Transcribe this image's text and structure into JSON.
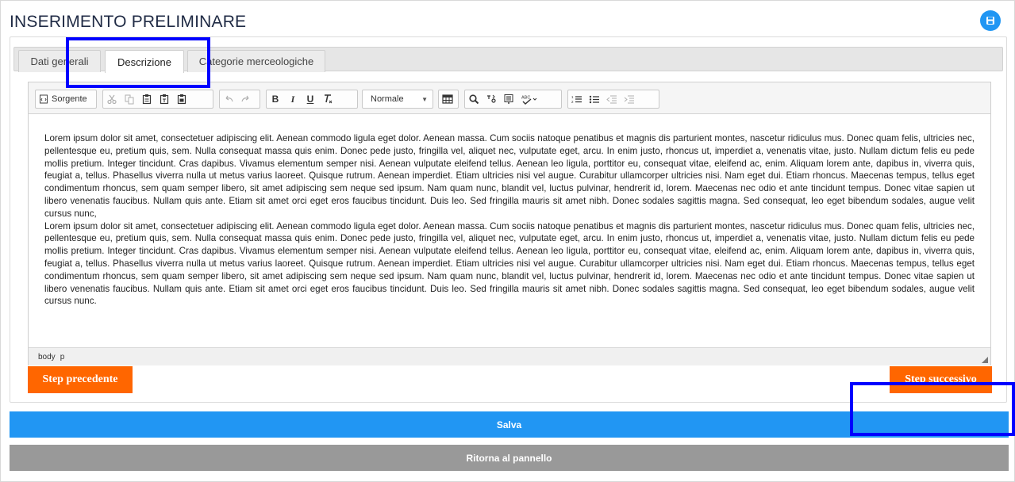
{
  "page": {
    "title": "INSERIMENTO PRELIMINARE"
  },
  "tabs": [
    {
      "label": "Dati generali"
    },
    {
      "label": "Descrizione"
    },
    {
      "label": "Categorie merceologiche"
    }
  ],
  "toolbar": {
    "source_label": "Sorgente",
    "bold_label": "B",
    "italic_label": "I",
    "underline_label": "U",
    "format_value": "Normale"
  },
  "editor": {
    "paragraph_1": "Lorem ipsum dolor sit amet, consectetuer adipiscing elit. Aenean commodo ligula eget dolor. Aenean massa. Cum sociis natoque penatibus et magnis dis parturient montes, nascetur ridiculus mus. Donec quam felis, ultricies nec, pellentesque eu, pretium quis, sem. Nulla consequat massa quis enim. Donec pede justo, fringilla vel, aliquet nec, vulputate eget, arcu. In enim justo, rhoncus ut, imperdiet a, venenatis vitae, justo. Nullam dictum felis eu pede mollis pretium. Integer tincidunt. Cras dapibus. Vivamus elementum semper nisi. Aenean vulputate eleifend tellus. Aenean leo ligula, porttitor eu, consequat vitae, eleifend ac, enim. Aliquam lorem ante, dapibus in, viverra quis, feugiat a, tellus. Phasellus viverra nulla ut metus varius laoreet. Quisque rutrum. Aenean imperdiet. Etiam ultricies nisi vel augue. Curabitur ullamcorper ultricies nisi. Nam eget dui. Etiam rhoncus. Maecenas tempus, tellus eget condimentum rhoncus, sem quam semper libero, sit amet adipiscing sem neque sed ipsum. Nam quam nunc, blandit vel, luctus pulvinar, hendrerit id, lorem. Maecenas nec odio et ante tincidunt tempus. Donec vitae sapien ut libero venenatis faucibus. Nullam quis ante. Etiam sit amet orci eget eros faucibus tincidunt. Duis leo. Sed fringilla mauris sit amet nibh. Donec sodales sagittis magna. Sed consequat, leo eget bibendum sodales, augue velit cursus nunc,",
    "paragraph_2": "Lorem ipsum dolor sit amet, consectetuer adipiscing elit. Aenean commodo ligula eget dolor. Aenean massa. Cum sociis natoque penatibus et magnis dis parturient montes, nascetur ridiculus mus. Donec quam felis, ultricies nec, pellentesque eu, pretium quis, sem. Nulla consequat massa quis enim. Donec pede justo, fringilla vel, aliquet nec, vulputate eget, arcu. In enim justo, rhoncus ut, imperdiet a, venenatis vitae, justo. Nullam dictum felis eu pede mollis pretium. Integer tincidunt. Cras dapibus. Vivamus elementum semper nisi. Aenean vulputate eleifend tellus. Aenean leo ligula, porttitor eu, consequat vitae, eleifend ac, enim. Aliquam lorem ante, dapibus in, viverra quis, feugiat a, tellus. Phasellus viverra nulla ut metus varius laoreet. Quisque rutrum. Aenean imperdiet. Etiam ultricies nisi vel augue. Curabitur ullamcorper ultricies nisi. Nam eget dui. Etiam rhoncus. Maecenas tempus, tellus eget condimentum rhoncus, sem quam semper libero, sit amet adipiscing sem neque sed ipsum. Nam quam nunc, blandit vel, luctus pulvinar, hendrerit id, lorem. Maecenas nec odio et ante tincidunt tempus. Donec vitae sapien ut libero venenatis faucibus. Nullam quis ante. Etiam sit amet orci eget eros faucibus tincidunt. Duis leo. Sed fringilla mauris sit amet nibh. Donec sodales sagittis magna. Sed consequat, leo eget bibendum sodales, augue velit cursus nunc.",
    "path": [
      "body",
      "p"
    ]
  },
  "actions": {
    "prev_label": "Step precedente",
    "next_label": "Step successivo",
    "save_label": "Salva",
    "back_label": "Ritorna al pannello"
  },
  "colors": {
    "primary": "#2196f3",
    "step_orange": "#ff6600",
    "back_gray": "#999999",
    "highlight": "#0000ff"
  }
}
